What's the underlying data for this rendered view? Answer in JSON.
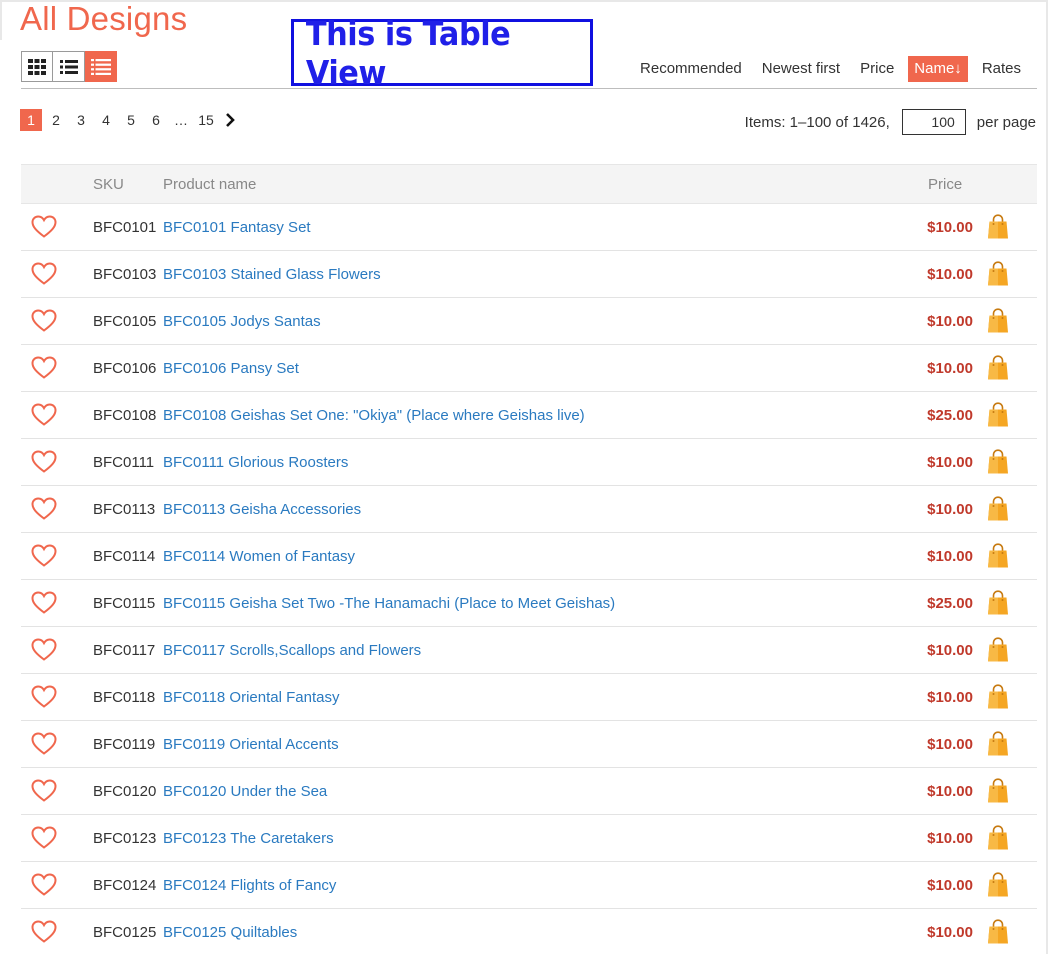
{
  "page": {
    "title": "All Designs",
    "banner_text": "This is Table View"
  },
  "view_modes": [
    {
      "name": "grid",
      "icon": "grid-icon",
      "active": false
    },
    {
      "name": "list",
      "icon": "list-icon",
      "active": false
    },
    {
      "name": "table",
      "icon": "table-icon",
      "active": true
    }
  ],
  "sort": {
    "options": [
      "Recommended",
      "Newest first",
      "Price",
      "Name↓",
      "Rates"
    ],
    "active_index": 3
  },
  "pagination": {
    "pages": [
      "1",
      "2",
      "3",
      "4",
      "5",
      "6",
      "…",
      "15"
    ],
    "current": "1",
    "next_icon": "chevron-right-icon"
  },
  "items_info": {
    "label": "Items: 1–100 of 1426,",
    "per_page_value": "100",
    "per_page_label": "per page"
  },
  "table": {
    "columns": {
      "sku": "SKU",
      "name": "Product name",
      "price": "Price"
    },
    "rows": [
      {
        "sku": "BFC0101",
        "name": "BFC0101 Fantasy Set",
        "price": "$10.00"
      },
      {
        "sku": "BFC0103",
        "name": "BFC0103 Stained Glass Flowers",
        "price": "$10.00"
      },
      {
        "sku": "BFC0105",
        "name": "BFC0105 Jodys Santas",
        "price": "$10.00"
      },
      {
        "sku": "BFC0106",
        "name": "BFC0106 Pansy Set",
        "price": "$10.00"
      },
      {
        "sku": "BFC0108",
        "name": "BFC0108 Geishas Set One: \"Okiya\" (Place where Geishas live)",
        "price": "$25.00"
      },
      {
        "sku": "BFC0111",
        "name": "BFC0111 Glorious Roosters",
        "price": "$10.00"
      },
      {
        "sku": "BFC0113",
        "name": "BFC0113 Geisha Accessories",
        "price": "$10.00"
      },
      {
        "sku": "BFC0114",
        "name": "BFC0114 Women of Fantasy",
        "price": "$10.00"
      },
      {
        "sku": "BFC0115",
        "name": "BFC0115 Geisha Set Two -The Hanamachi (Place to Meet Geishas)",
        "price": "$25.00"
      },
      {
        "sku": "BFC0117",
        "name": "BFC0117 Scrolls,Scallops and Flowers",
        "price": "$10.00"
      },
      {
        "sku": "BFC0118",
        "name": "BFC0118 Oriental Fantasy",
        "price": "$10.00"
      },
      {
        "sku": "BFC0119",
        "name": "BFC0119 Oriental Accents",
        "price": "$10.00"
      },
      {
        "sku": "BFC0120",
        "name": "BFC0120 Under the Sea",
        "price": "$10.00"
      },
      {
        "sku": "BFC0123",
        "name": "BFC0123 The Caretakers",
        "price": "$10.00"
      },
      {
        "sku": "BFC0124",
        "name": "BFC0124 Flights of Fancy",
        "price": "$10.00"
      },
      {
        "sku": "BFC0125",
        "name": "BFC0125 Quiltables",
        "price": "$10.00"
      }
    ],
    "row_icons": {
      "wishlist": "heart-icon",
      "cart": "shopping-bag-icon"
    }
  },
  "colors": {
    "accent": "#f0674d",
    "link": "#2a7ac0",
    "price": "#c0392b",
    "banner": "#2020e8",
    "cart": "#f5a623"
  }
}
